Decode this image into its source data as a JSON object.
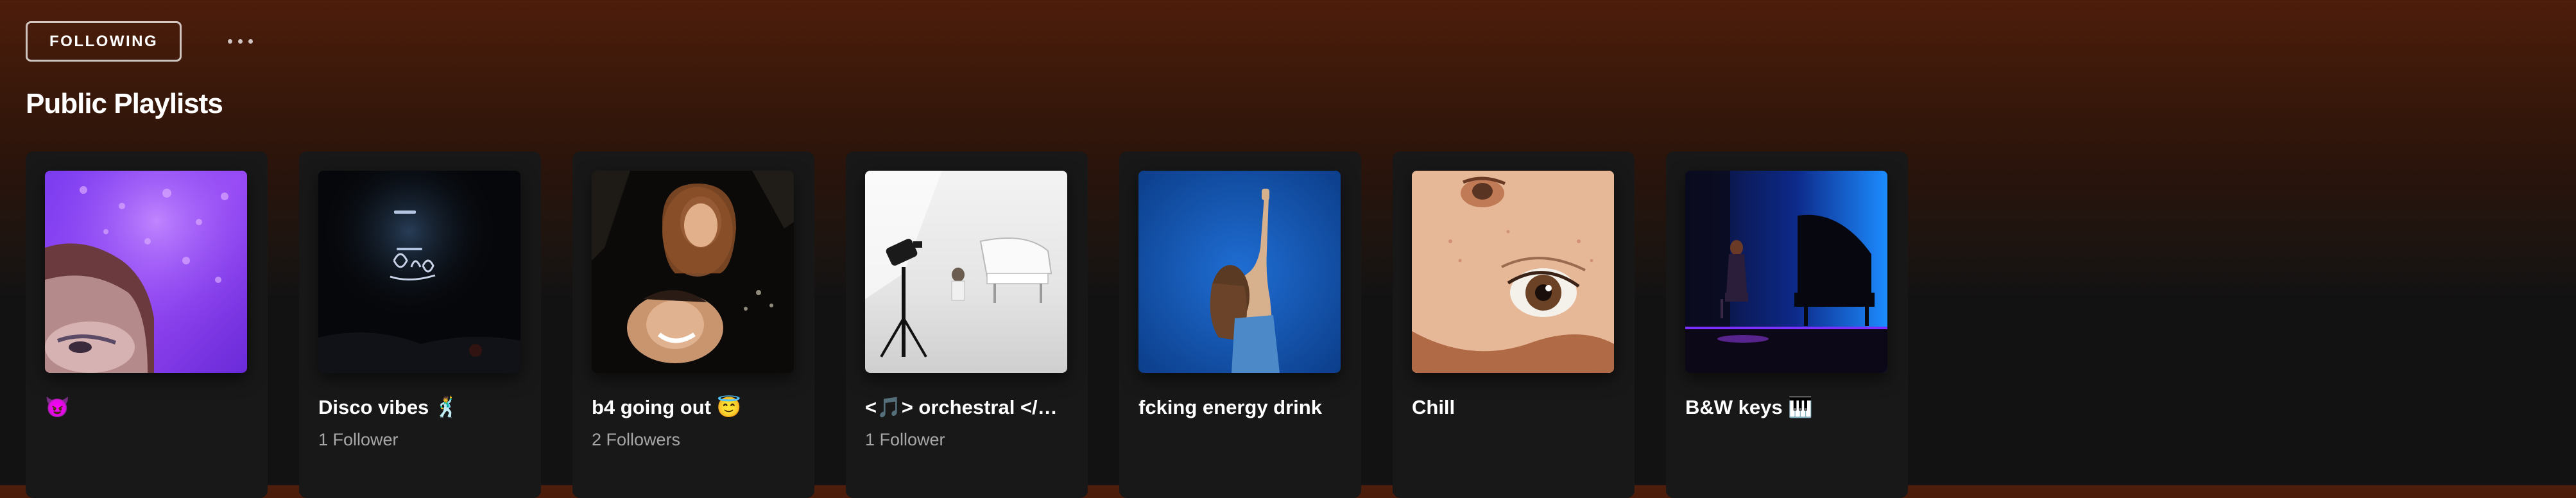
{
  "profile": {
    "follow_button_label": "FOLLOWING",
    "more_options_icon": "more-horizontal-icon"
  },
  "section": {
    "title": "Public Playlists"
  },
  "playlists": [
    {
      "title": "😈",
      "subtitle": ""
    },
    {
      "title": "Disco vibes 🕺",
      "subtitle": "1 Follower"
    },
    {
      "title": "b4 going out 😇",
      "subtitle": "2 Followers"
    },
    {
      "title": "<🎵> orchestral </🎵>",
      "subtitle": "1 Follower"
    },
    {
      "title": "fcking energy drink",
      "subtitle": ""
    },
    {
      "title": "Chill",
      "subtitle": ""
    },
    {
      "title": "B&W keys 🎹",
      "subtitle": ""
    }
  ],
  "colors": {
    "header_gradient_top": "#4e1d0b",
    "background": "#121212",
    "card": "#181818",
    "subtext": "#a7a7a7"
  }
}
